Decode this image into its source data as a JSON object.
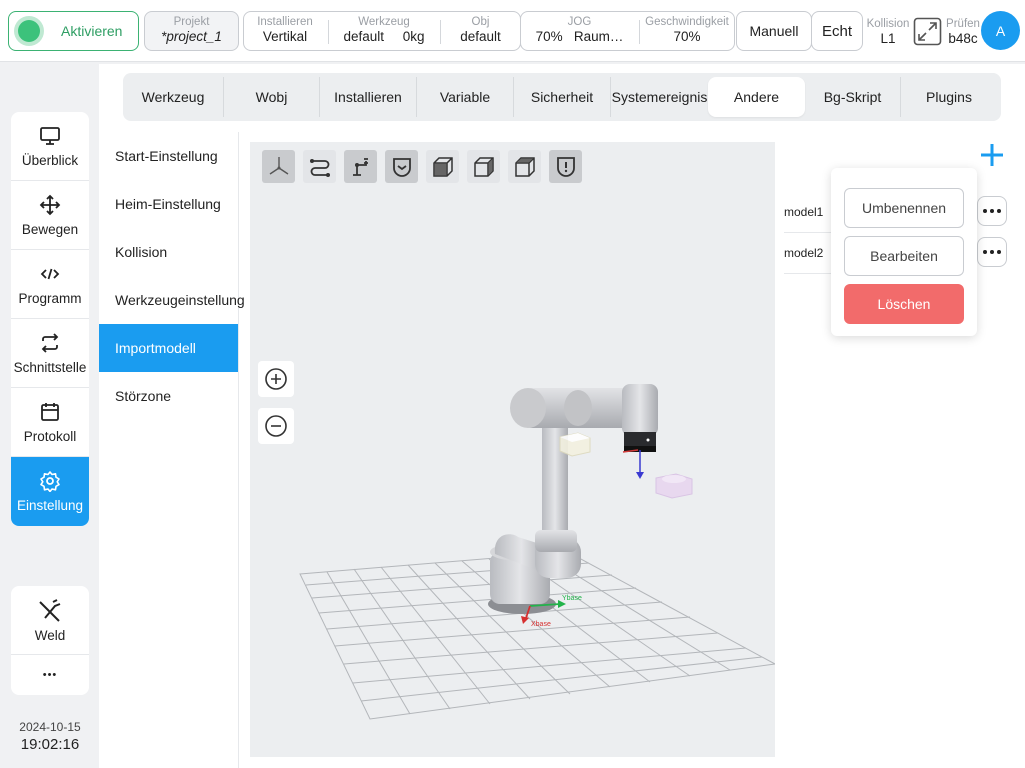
{
  "header": {
    "activate_label": "Aktivieren",
    "project": {
      "caption": "Projekt",
      "value": "*project_1"
    },
    "install": {
      "caption": "Installieren",
      "value": "Vertikal"
    },
    "tool": {
      "caption": "Werkzeug",
      "value": "default",
      "payload": "0kg"
    },
    "obj": {
      "caption": "Obj",
      "value": "default"
    },
    "jog": {
      "caption": "JOG",
      "value": "70%",
      "frame": "Raum…"
    },
    "speed": {
      "caption": "Geschwindigkeit",
      "value": "70%"
    },
    "mode_label": "Manuell",
    "real_label": "Echt",
    "collision": {
      "caption": "Kollision",
      "value": "L1"
    },
    "check": {
      "caption": "Prüfen",
      "value": "b48c"
    },
    "avatar_label": "A"
  },
  "sidebar": {
    "items": [
      {
        "label": "Überblick",
        "icon": "monitor-icon"
      },
      {
        "label": "Bewegen",
        "icon": "move-icon"
      },
      {
        "label": "Programm",
        "icon": "code-icon"
      },
      {
        "label": "Schnittstelle",
        "icon": "swap-icon"
      },
      {
        "label": "Protokoll",
        "icon": "calendar-icon"
      },
      {
        "label": "Einstellung",
        "icon": "gear-icon",
        "active": true
      }
    ],
    "plugins": [
      {
        "label": "Weld",
        "icon": "weld-torch-icon"
      },
      {
        "label": "•••",
        "icon": "more-icon"
      }
    ],
    "date": "2024-10-15",
    "time": "19:02:16"
  },
  "tabs": [
    {
      "label": "Werkzeug"
    },
    {
      "label": "Wobj"
    },
    {
      "label": "Installieren"
    },
    {
      "label": "Variable"
    },
    {
      "label": "Sicherheit"
    },
    {
      "label": "Systemereignis"
    },
    {
      "label": "Andere",
      "active": true
    },
    {
      "label": "Bg-Skript"
    },
    {
      "label": "Plugins"
    }
  ],
  "submenu": [
    {
      "label": "Start-Einstellung"
    },
    {
      "label": "Heim-Einstellung"
    },
    {
      "label": "Kollision"
    },
    {
      "label": "Werkzeugeinstellung"
    },
    {
      "label": "Importmodell",
      "active": true
    },
    {
      "label": "Störzone"
    }
  ],
  "viewport": {
    "axis_labels": {
      "x": "Xbase",
      "y": "Ybase"
    },
    "zoom_in_icon": "zoom-in-icon",
    "zoom_out_icon": "zoom-out-icon"
  },
  "models": [
    {
      "name": "model1"
    },
    {
      "name": "model2"
    }
  ],
  "context_menu": {
    "rename": "Umbenennen",
    "edit": "Bearbeiten",
    "delete": "Löschen"
  },
  "colors": {
    "accent": "#1a9cf0",
    "active_green": "#3cc27b",
    "danger": "#f26b6b"
  }
}
